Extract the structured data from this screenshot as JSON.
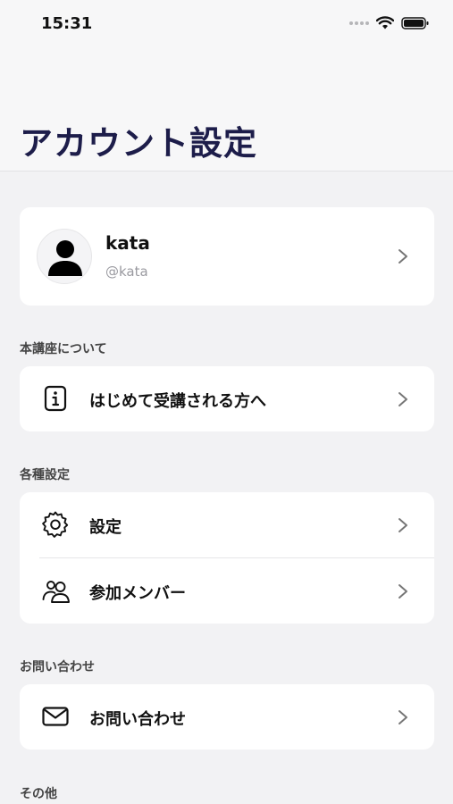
{
  "status_bar": {
    "time": "15:31"
  },
  "header": {
    "title": "アカウント設定"
  },
  "profile": {
    "name": "kata",
    "handle": "@kata"
  },
  "sections": {
    "about": {
      "label": "本講座について",
      "items": [
        {
          "label": "はじめて受講される方へ"
        }
      ]
    },
    "settings": {
      "label": "各種設定",
      "items": [
        {
          "label": "設定"
        },
        {
          "label": "参加メンバー"
        }
      ]
    },
    "contact": {
      "label": "お問い合わせ",
      "items": [
        {
          "label": "お問い合わせ"
        }
      ]
    },
    "other": {
      "label": "その他"
    }
  },
  "icons": {
    "about_item": "info-icon",
    "settings_item": "gear-icon",
    "members_item": "people-icon",
    "contact_item": "mail-icon",
    "chevron": "chevron-right-icon"
  },
  "colors": {
    "title": "#1d1d4a",
    "background": "#f2f2f4",
    "card": "#ffffff"
  }
}
